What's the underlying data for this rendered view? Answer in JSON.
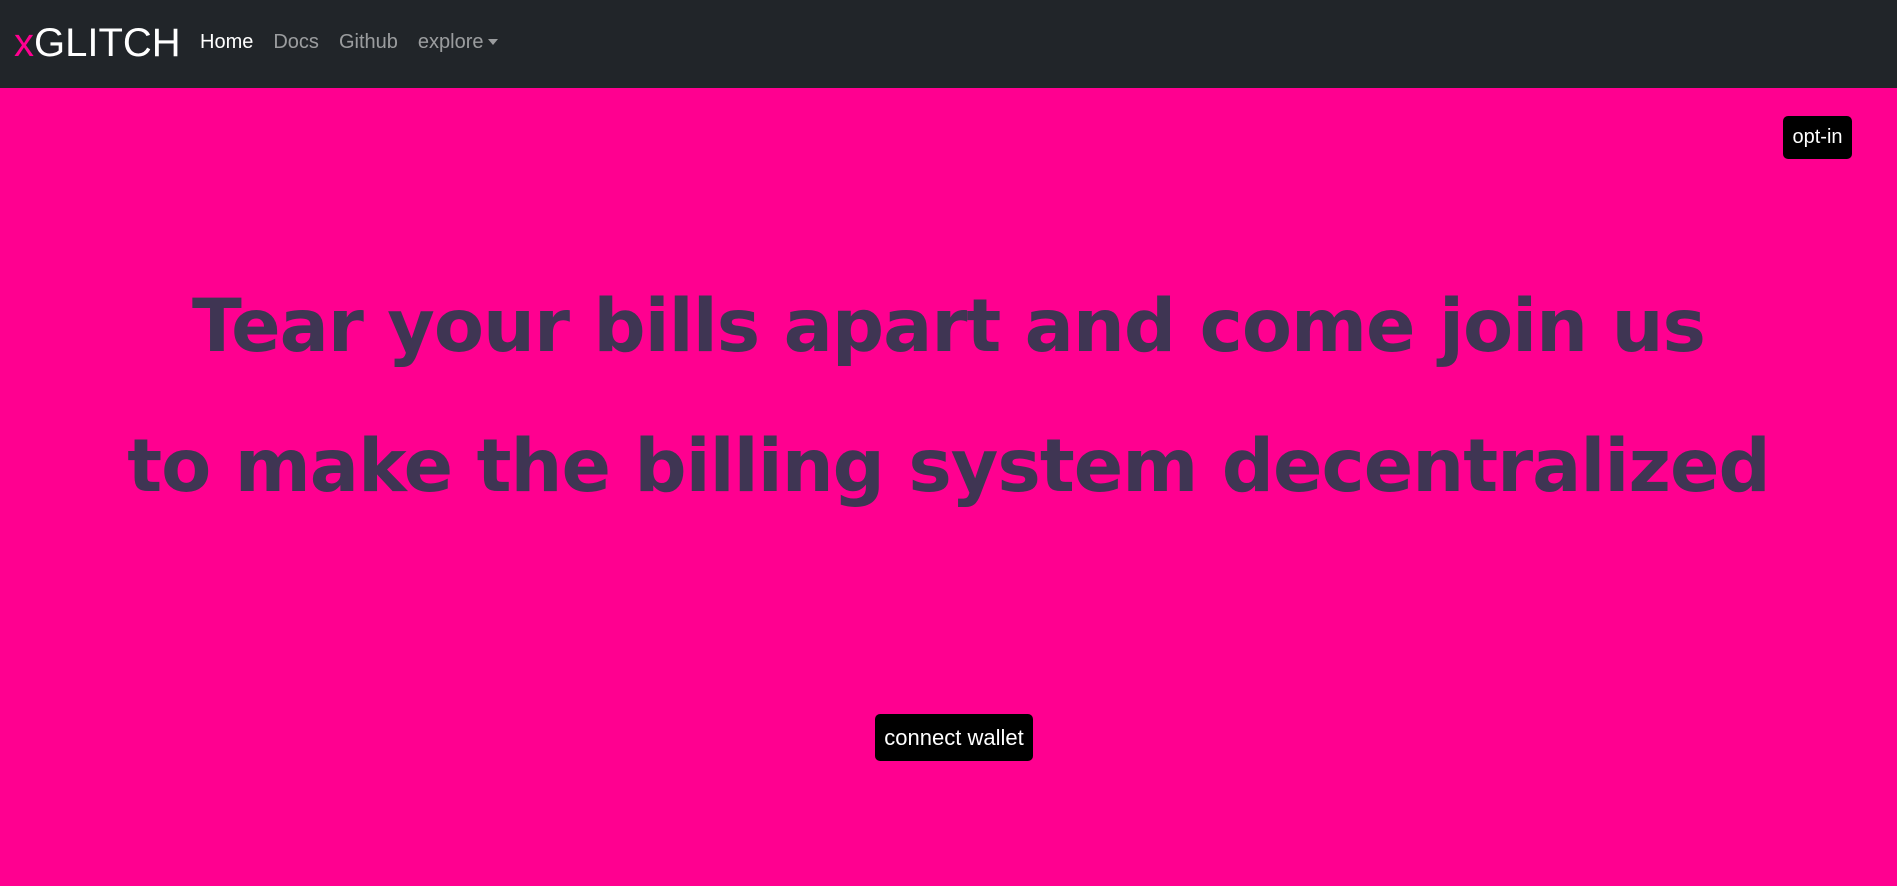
{
  "navbar": {
    "brand_prefix": "x",
    "brand_name": "GLITCH",
    "links": [
      {
        "label": "Home"
      },
      {
        "label": "Docs"
      },
      {
        "label": "Github"
      },
      {
        "label": "explore"
      }
    ]
  },
  "actions": {
    "optin_label": "opt-in",
    "connect_label": "connect wallet"
  },
  "hero": {
    "line1": "Tear your bills apart and come join us",
    "line2": "to make the billing system decentralized"
  },
  "colors": {
    "background": "#ff0090",
    "navbar": "#212529",
    "brand_accent": "#ff0090",
    "headline": "#3f3553",
    "button": "#000000"
  }
}
